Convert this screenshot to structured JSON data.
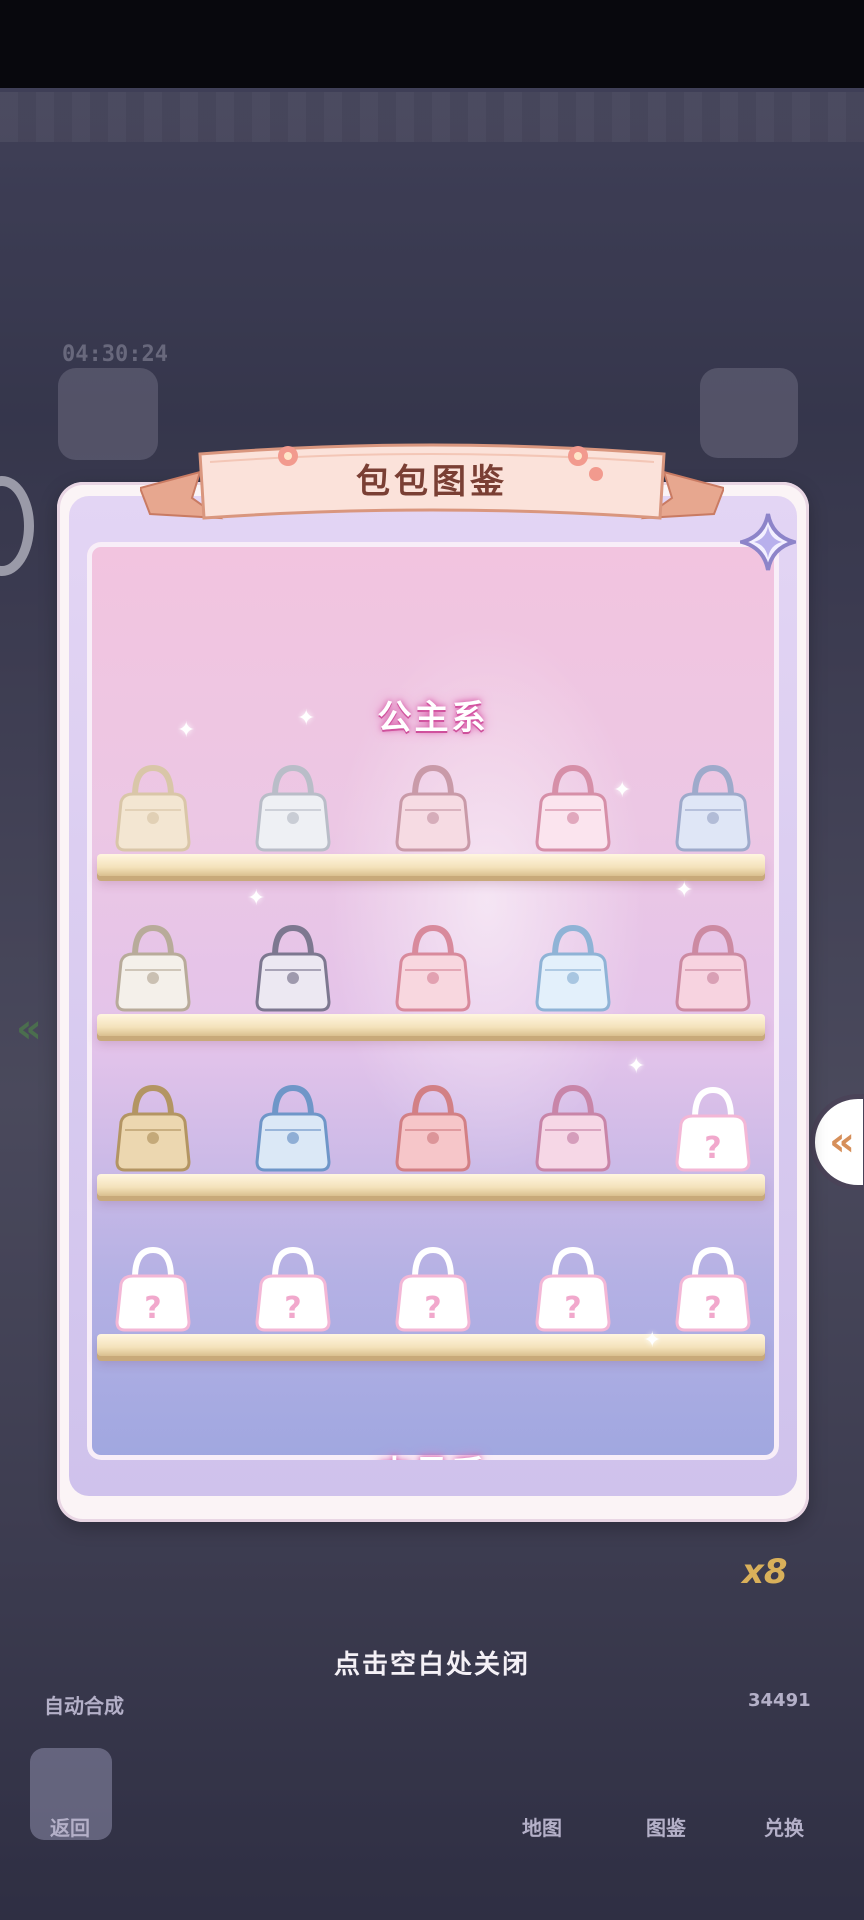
{
  "background": {
    "timer": "04:30:24",
    "auto_merge_label": "自动合成",
    "back_label": "返回",
    "nav": {
      "map": "地图",
      "catalog": "图鉴",
      "exchange": "兑换"
    },
    "multiplier": "x8",
    "counter": "34491"
  },
  "dialog": {
    "title": "包包图鉴",
    "section_1": "公主系",
    "section_2": "中号系",
    "shelves": [
      {
        "items": [
          {
            "icon": "pearl-shell-bag",
            "unlocked": true
          },
          {
            "icon": "pearl-flap-bag",
            "unlocked": true
          },
          {
            "icon": "pink-handbag",
            "unlocked": true
          },
          {
            "icon": "bow-pearl-bag",
            "unlocked": true
          },
          {
            "icon": "blue-quilted-bag",
            "unlocked": true
          }
        ]
      },
      {
        "items": [
          {
            "icon": "bow-tote-bag",
            "unlocked": true
          },
          {
            "icon": "sequin-frame-bag",
            "unlocked": true
          },
          {
            "icon": "rose-ribbon-bag",
            "unlocked": true
          },
          {
            "icon": "blue-bow-bag",
            "unlocked": true
          },
          {
            "icon": "pink-charm-bag",
            "unlocked": true
          }
        ]
      },
      {
        "items": [
          {
            "icon": "floral-clutch",
            "unlocked": true
          },
          {
            "icon": "blue-ring-bag",
            "unlocked": true
          },
          {
            "icon": "pink-bow-bag",
            "unlocked": true
          },
          {
            "icon": "lace-bow-bag",
            "unlocked": true
          },
          {
            "icon": "locked-bag",
            "unlocked": false,
            "label": "?"
          }
        ]
      },
      {
        "items": [
          {
            "icon": "locked-bag",
            "unlocked": false,
            "label": "?"
          },
          {
            "icon": "locked-bag",
            "unlocked": false,
            "label": "?"
          },
          {
            "icon": "locked-bag",
            "unlocked": false,
            "label": "?"
          },
          {
            "icon": "locked-bag",
            "unlocked": false,
            "label": "?"
          },
          {
            "icon": "locked-bag",
            "unlocked": false,
            "label": "?"
          }
        ]
      }
    ],
    "close_hint": "点击空白处关闭"
  },
  "colors": {
    "title_text": "#7a3f34",
    "section_glow": "#d24c9e",
    "panel_bg": "#fbf4f6",
    "shelf": "#f4e2bb"
  }
}
